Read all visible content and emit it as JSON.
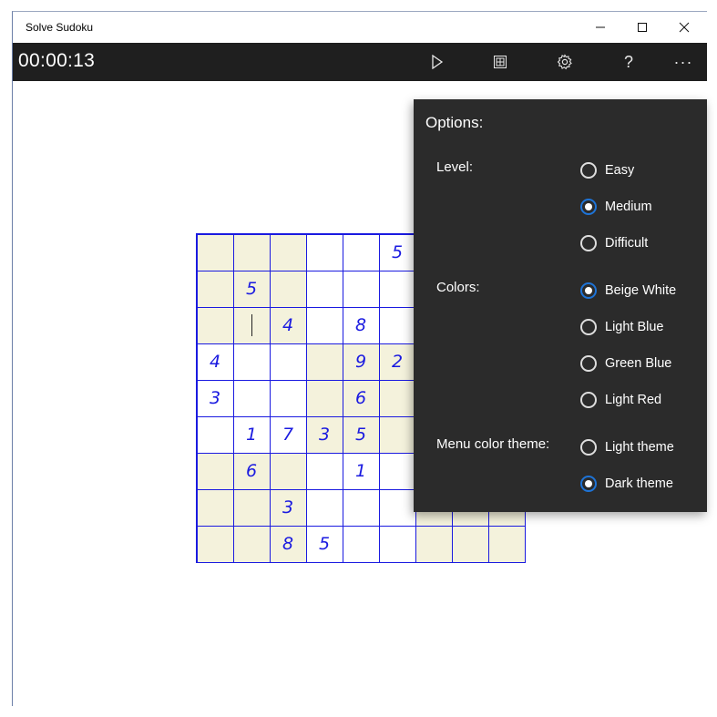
{
  "window": {
    "title": "Solve Sudoku"
  },
  "toolbar": {
    "timer": "00:00:13",
    "icons": [
      "play-icon",
      "grid-icon",
      "gear-icon",
      "help-icon",
      "more-icon"
    ],
    "help_label": "?",
    "more_label": "···"
  },
  "options": {
    "title": "Options:",
    "level": {
      "label": "Level:",
      "items": [
        "Easy",
        "Medium",
        "Difficult"
      ],
      "selected": "Medium"
    },
    "colors": {
      "label": "Colors:",
      "items": [
        "Beige White",
        "Light Blue",
        "Green Blue",
        "Light Red"
      ],
      "selected": "Beige White"
    },
    "menu_theme": {
      "label": "Menu color theme:",
      "items": [
        "Light theme",
        "Dark theme"
      ],
      "selected": "Dark theme"
    }
  },
  "board": {
    "rows": [
      [
        "",
        "",
        "",
        "",
        "",
        "5",
        "",
        "",
        ""
      ],
      [
        "",
        "5",
        "",
        "",
        "",
        "",
        "",
        "",
        ""
      ],
      [
        "",
        "",
        "4",
        "",
        "8",
        "",
        "",
        "",
        ""
      ],
      [
        "4",
        "",
        "",
        "",
        "9",
        "2",
        "",
        "",
        ""
      ],
      [
        "3",
        "",
        "",
        "",
        "6",
        "",
        "",
        "",
        ""
      ],
      [
        "",
        "1",
        "7",
        "3",
        "5",
        "",
        "",
        "",
        ""
      ],
      [
        "",
        "6",
        "",
        "",
        "1",
        "",
        "",
        "",
        ""
      ],
      [
        "",
        "",
        "3",
        "",
        "",
        "",
        "",
        "",
        ""
      ],
      [
        "",
        "",
        "8",
        "5",
        "",
        "",
        "",
        "",
        ""
      ]
    ],
    "cursor_cell": [
      2,
      1
    ],
    "colors": {
      "shaded": "#f4f2dc",
      "line": "#1a1ae0",
      "digit": "#1a1ae0"
    }
  },
  "colors": {
    "toolbar_bg": "#1f1f1f",
    "panel_bg": "#2b2b2b",
    "accent": "#1e73d6"
  }
}
